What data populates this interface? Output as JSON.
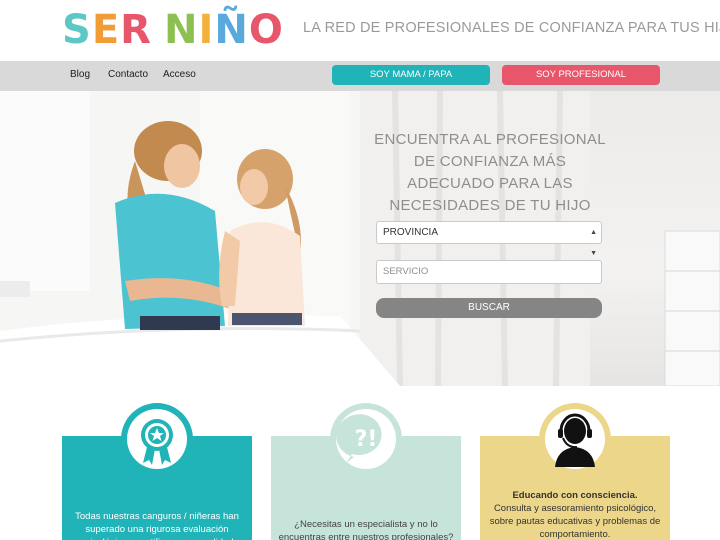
{
  "header": {
    "logo_letters": [
      "S",
      "E",
      "R",
      " ",
      "N",
      "I",
      "Ñ",
      "O"
    ],
    "logo_text": "SER NIÑO",
    "tagline": "LA RED DE PROFESIONALES DE CONFIANZA PARA TUS HIJOS"
  },
  "nav": {
    "links": [
      "Blog",
      "Contacto",
      "Acceso"
    ],
    "parent_button": "SOY MAMA / PAPA",
    "pro_button": "SOY PROFESIONAL"
  },
  "hero": {
    "title": "ENCUENTRA AL PROFESIONAL DE CONFIANZA MÁS ADECUADO PARA LAS NECESIDADES DE TU HIJO",
    "province_select": "PROVINCIA",
    "service_placeholder": "SERVICIO",
    "search_button": "BUSCAR"
  },
  "cards": [
    {
      "icon": "ribbon-award-icon",
      "text": "Todas nuestras canguros / niñeras han superado una rigurosa evaluación psicológica y certificamos su calidad"
    },
    {
      "icon": "question-speech-bubble-icon",
      "text": "¿Necesitas un especialista y no lo encuentras entre nuestros profesionales?"
    },
    {
      "icon": "headset-advisor-icon",
      "title": "Educando con consciencia.",
      "text": "Consulta y asesoramiento psicológico, sobre pautas educativas y problemas de comportamiento."
    }
  ],
  "colors": {
    "teal": "#20b3b8",
    "pink": "#e8566b",
    "mint": "#c6e4da",
    "gold": "#ecd68a",
    "gray_button": "#858585",
    "navbar": "#d9d9d9"
  }
}
